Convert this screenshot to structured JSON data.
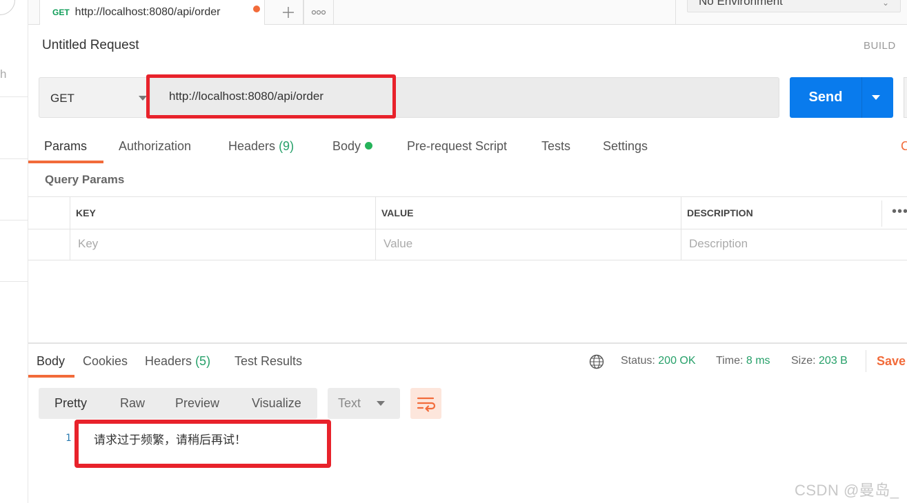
{
  "tab": {
    "method": "GET",
    "url": "http://localhost:8080/api/order"
  },
  "environment": {
    "label": "No Environment"
  },
  "request": {
    "title": "Untitled Request",
    "build_label": "BUILD",
    "method": "GET",
    "url": "http://localhost:8080/api/order",
    "send_label": "Send"
  },
  "request_tabs": {
    "params": "Params",
    "authorization": "Authorization",
    "headers": "Headers",
    "headers_count": "(9)",
    "body": "Body",
    "prerequest": "Pre-request Script",
    "tests": "Tests",
    "settings": "Settings",
    "cookies_clipped": "C"
  },
  "query_params": {
    "label": "Query Params",
    "columns": [
      "KEY",
      "VALUE",
      "DESCRIPTION"
    ],
    "placeholders": [
      "Key",
      "Value",
      "Description"
    ]
  },
  "response_tabs": {
    "body": "Body",
    "cookies": "Cookies",
    "headers": "Headers",
    "headers_count": "(5)",
    "test_results": "Test Results"
  },
  "response_status": {
    "status_label": "Status:",
    "status_value": "200 OK",
    "time_label": "Time:",
    "time_value": "8 ms",
    "size_label": "Size:",
    "size_value": "203 B",
    "save_label": "Save"
  },
  "response_format": {
    "pretty": "Pretty",
    "raw": "Raw",
    "preview": "Preview",
    "visualize": "Visualize",
    "type": "Text"
  },
  "response_body": {
    "line_number": "1",
    "text": "请求过于频繁，请稍后再试！"
  },
  "watermark": "CSDN @曼岛_",
  "sidebar_clipped_text": "h",
  "colors": {
    "accent": "#f26b3a",
    "send": "#097bed",
    "highlight": "#e8222b",
    "success": "#26a069"
  }
}
